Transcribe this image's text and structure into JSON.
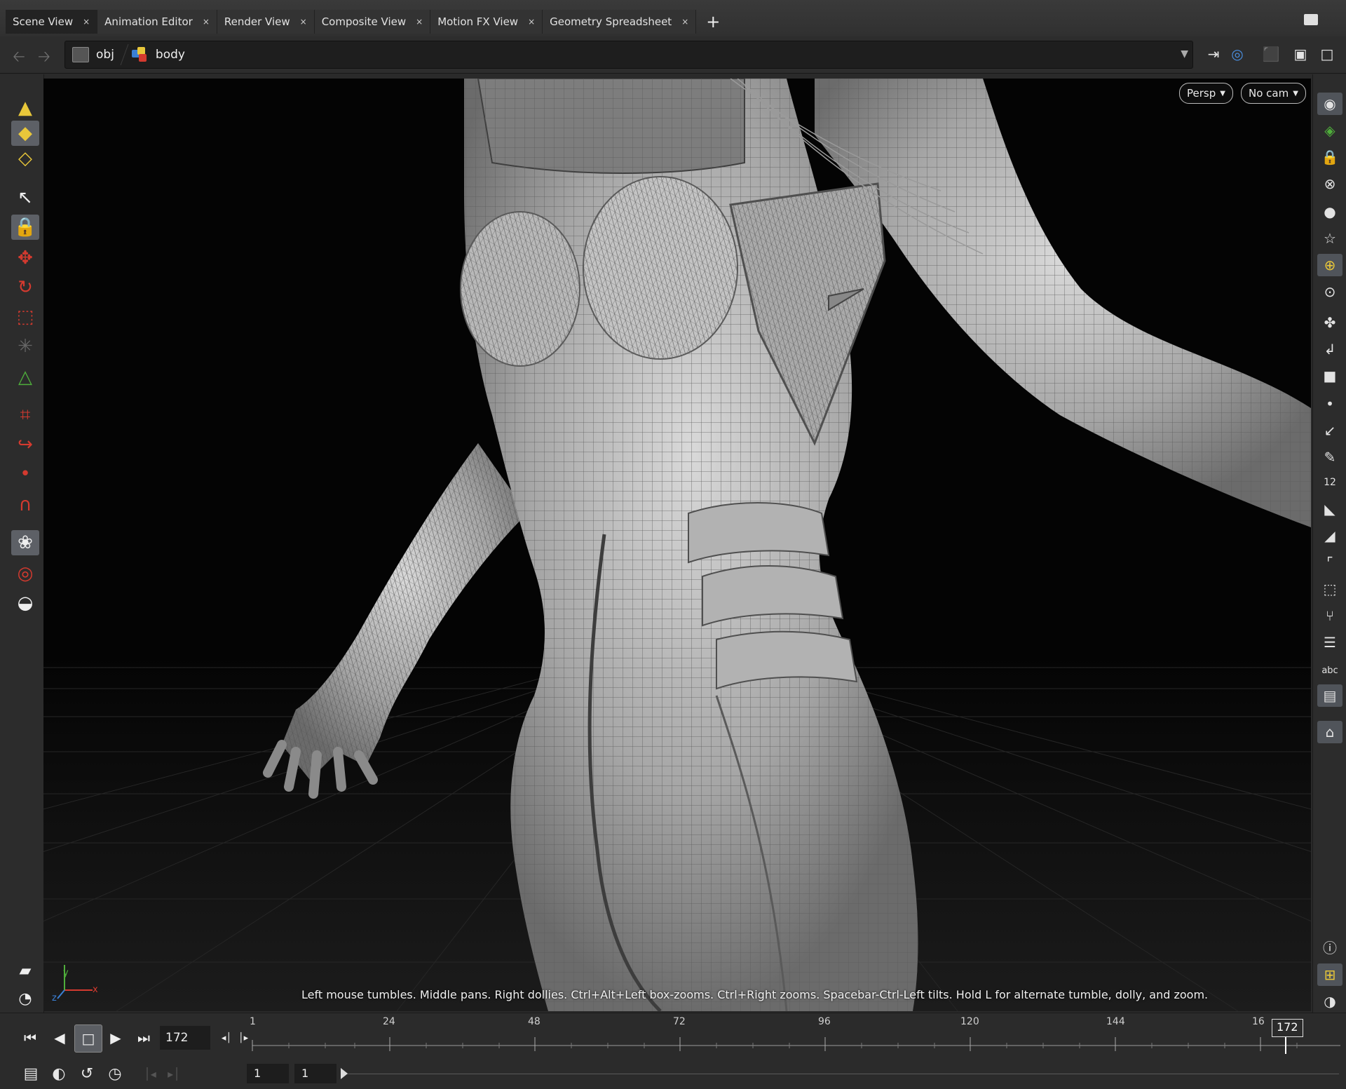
{
  "tabs": [
    {
      "label": "Scene View"
    },
    {
      "label": "Animation Editor"
    },
    {
      "label": "Render View"
    },
    {
      "label": "Composite View"
    },
    {
      "label": "Motion FX View"
    },
    {
      "label": "Geometry Spreadsheet"
    }
  ],
  "tab_close_glyph": "×",
  "tab_add_glyph": "+",
  "path": {
    "root": "obj",
    "node": "body"
  },
  "viewport": {
    "camera_mode": "Persp",
    "camera": "No cam",
    "hint": "Left mouse tumbles. Middle pans. Right dollies. Ctrl+Alt+Left box-zooms. Ctrl+Right zooms. Spacebar-Ctrl-Left tilts. Hold L for alternate tumble, dolly, and zoom.",
    "axis_x": "x",
    "axis_y": "y",
    "axis_z": "z"
  },
  "right_toolbar": {
    "frame_text": "12",
    "abc_label": "abc"
  },
  "playbar": {
    "current_frame": "172",
    "start_frame": "1",
    "end_frame": "1",
    "timeline_ticks": [
      "1",
      "24",
      "48",
      "72",
      "96",
      "120",
      "144",
      "16"
    ],
    "cursor_frame": "172"
  },
  "colors": {
    "accent_red": "#d43a2f",
    "accent_yellow": "#e8c73a",
    "accent_green": "#4fae3b",
    "accent_blue": "#3a7fd4"
  }
}
